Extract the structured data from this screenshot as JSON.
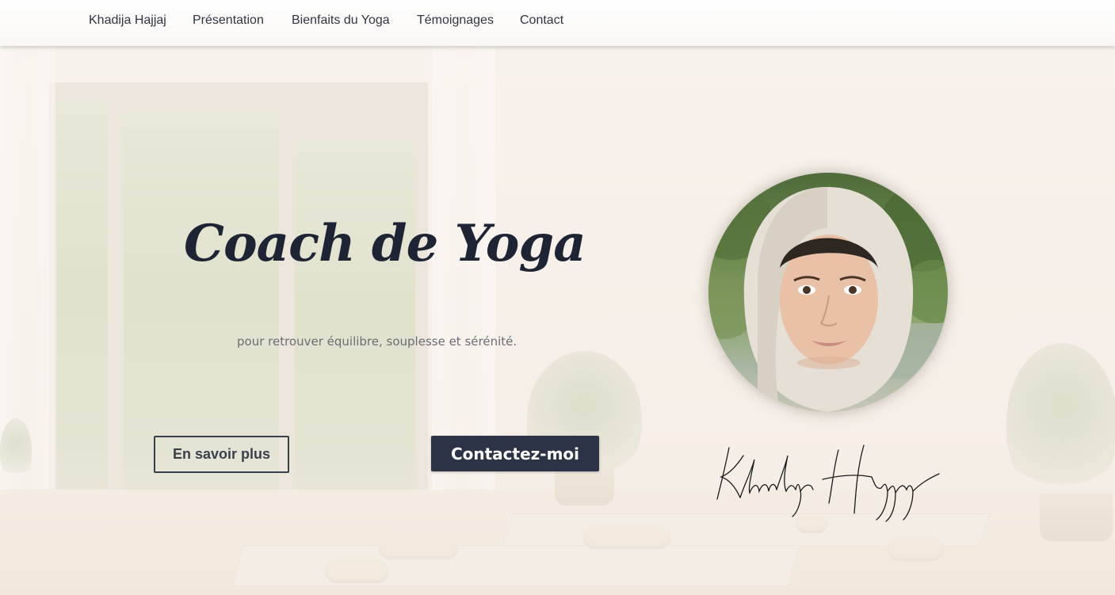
{
  "nav": {
    "items": [
      {
        "label": "Khadija Hajjaj"
      },
      {
        "label": "Présentation"
      },
      {
        "label": "Bienfaits du Yoga"
      },
      {
        "label": "Témoignages"
      },
      {
        "label": "Contact"
      }
    ]
  },
  "hero": {
    "title": "Coach de Yoga",
    "subtitle": "pour retrouver équilibre, souplesse et sérénité.",
    "primary_button": "Contactez-moi",
    "secondary_button": "En savoir plus",
    "signature": "Khadija Hajjaj"
  },
  "colors": {
    "title": "#1e2434",
    "button_dark": "#2c3346",
    "text_muted": "#6b6d72",
    "background": "#f3ece6"
  },
  "icons": {
    "portrait": "coach-portrait",
    "signature": "handwritten-signature"
  }
}
